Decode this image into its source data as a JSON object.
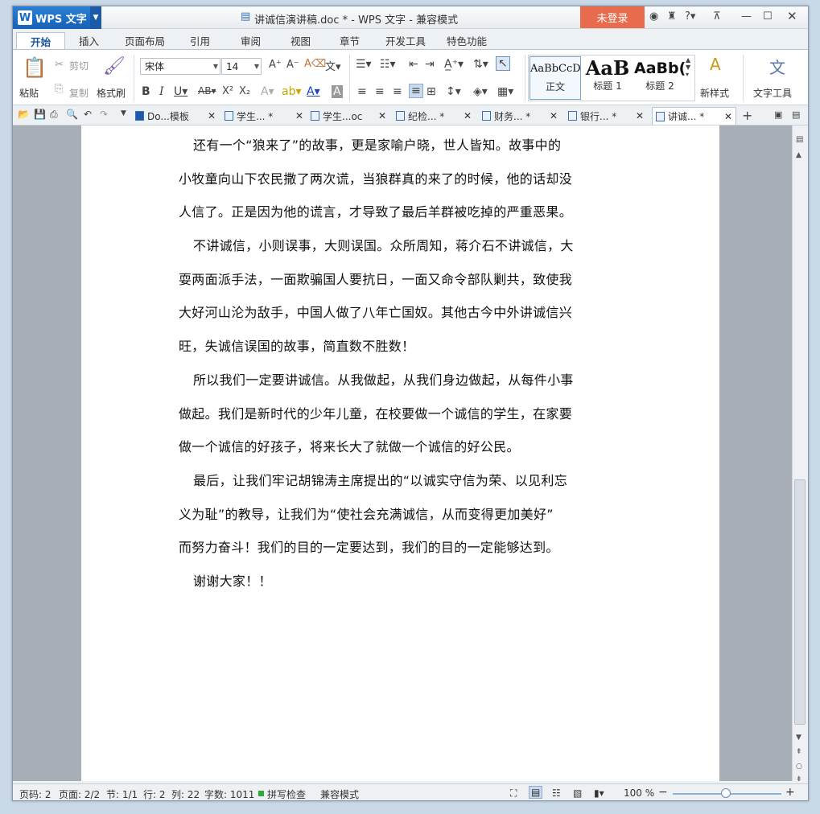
{
  "app": {
    "name": "WPS 文字",
    "logo": "W"
  },
  "title": "讲诚信演讲稿.doc * - WPS 文字 - 兼容模式",
  "login_label": "未登录",
  "menu_tabs": [
    "开始",
    "插入",
    "页面布局",
    "引用",
    "审阅",
    "视图",
    "章节",
    "开发工具",
    "特色功能"
  ],
  "ribbon": {
    "paste": "粘贴",
    "cut": "剪切",
    "copy": "复制",
    "format_painter": "格式刷",
    "font_name": "宋体",
    "font_size": "14",
    "styles": [
      {
        "sample": "AaBbCcD",
        "label": "正文"
      },
      {
        "sample": "AaB",
        "label": "标题 1"
      },
      {
        "sample": "AaBb(",
        "label": "标题 2"
      }
    ],
    "new_style": "新样式",
    "text_tools": "文字工具"
  },
  "doc_tabs": [
    "Do...模板",
    "学生... *",
    "学生...oc",
    "纪检... *",
    "财务... *",
    "银行... *",
    "讲诚... *"
  ],
  "document": {
    "paragraphs": [
      [
        "还有一个“狼来了”的故事，更是家喻户晓，世人皆知。故事中的",
        "小牧童向山下农民撒了两次谎，当狼群真的来了的时候，他的话却没",
        "人信了。正是因为他的谎言，才导致了最后羊群被吃掉的严重恶果。"
      ],
      [
        "不讲诚信，小则误事，大则误国。众所周知，蒋介石不讲诚信，大",
        "耍两面派手法，一面欺骗国人要抗日，一面又命令部队剿共，致使我",
        "大好河山沦为敌手，中国人做了八年亡国奴。其他古今中外讲诚信兴",
        "旺，失诚信误国的故事，简直数不胜数！"
      ],
      [
        "所以我们一定要讲诚信。从我做起，从我们身边做起，从每件小事",
        "做起。我们是新时代的少年儿童，在校要做一个诚信的学生，在家要",
        "做一个诚信的好孩子，将来长大了就做一个诚信的好公民。"
      ],
      [
        "最后，让我们牢记胡锦涛主席提出的“以诚实守信为荣、以见利忘",
        "义为耻”的教导，让我们为“使社会充满诚信，从而变得更加美好”",
        "而努力奋斗！我们的目的一定要达到，我们的目的一定能够达到。"
      ],
      [
        "谢谢大家！！"
      ]
    ]
  },
  "status": {
    "page_num": "页码: 2",
    "pages": "页面: 2/2",
    "section": "节: 1/1",
    "row": "行: 2",
    "col": "列: 22",
    "word_count": "字数: 1011",
    "spell_check": "拼写检查",
    "compat_mode": "兼容模式",
    "zoom": "100 %"
  },
  "colors": {
    "login": "#e96b4d",
    "accent": "#1a6ac2"
  }
}
